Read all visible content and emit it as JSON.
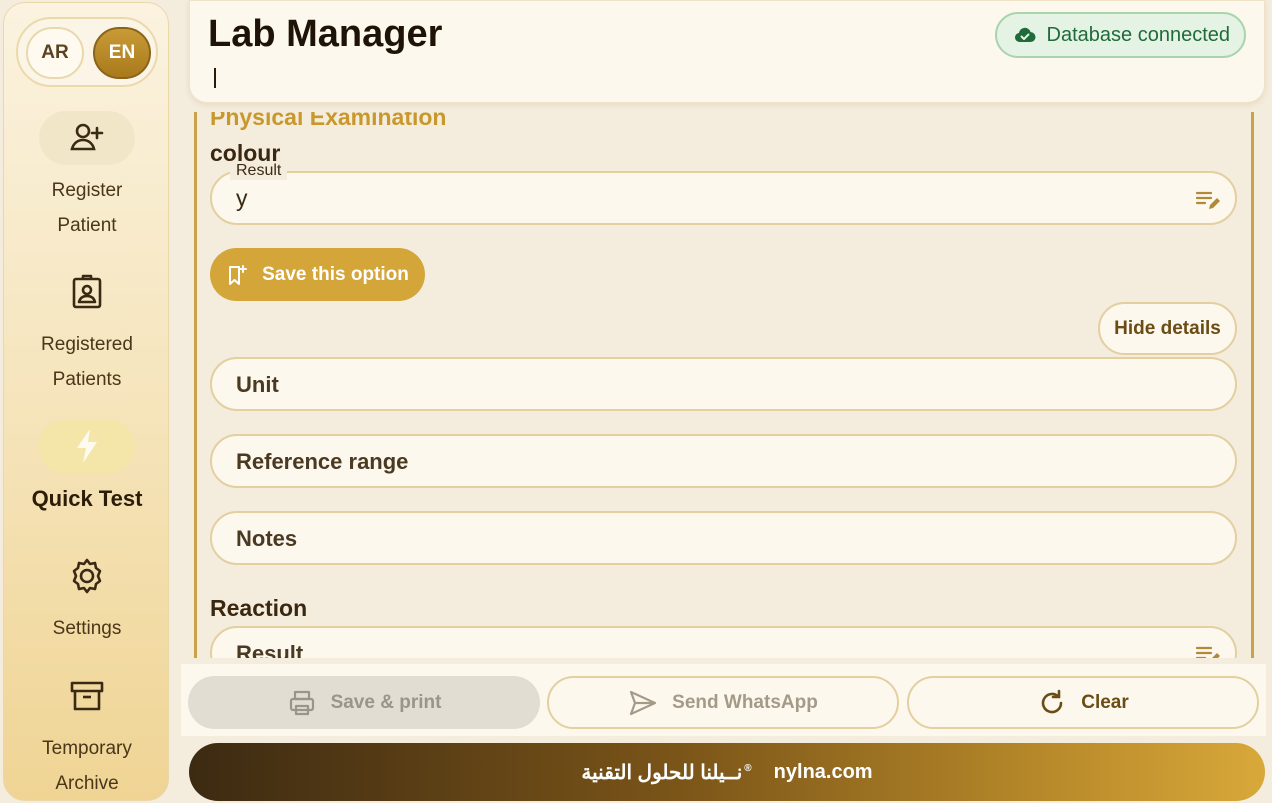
{
  "sidebar": {
    "lang": {
      "ar": "AR",
      "en": "EN",
      "active": "EN"
    },
    "items": [
      {
        "id": "register-patient",
        "line1": "Register",
        "line2": "Patient",
        "icon": "user-plus-icon"
      },
      {
        "id": "registered-patients",
        "line1": "Registered",
        "line2": "Patients",
        "icon": "id-badge-icon"
      },
      {
        "id": "quick-test",
        "line1": "Quick Test",
        "line2": "",
        "icon": "lightning-icon",
        "active": true
      },
      {
        "id": "settings",
        "line1": "Settings",
        "line2": "",
        "icon": "gear-icon"
      },
      {
        "id": "temporary-archive",
        "line1": "Temporary",
        "line2": "Archive",
        "icon": "archive-box-icon"
      }
    ]
  },
  "header": {
    "title": "Lab Manager",
    "db_status": "Database connected",
    "db_status_color": "#1f6b3a"
  },
  "main": {
    "section_title": "Physical Examination",
    "test1": {
      "name": "colour",
      "result_legend": "Result",
      "result_value": "y",
      "save_option_label": "Save this option",
      "hide_details_label": "Hide details",
      "unit_placeholder": "Unit",
      "reference_placeholder": "Reference range",
      "notes_placeholder": "Notes"
    },
    "test2": {
      "name": "Reaction",
      "result_placeholder": "Result"
    }
  },
  "actions": {
    "print_label": "Save & print",
    "whatsapp_label": "Send WhatsApp",
    "clear_label": "Clear"
  },
  "footer": {
    "arabic_brand": "نــيلنا للحلول التقنية",
    "reg_mark": "®",
    "site": "nylna.com"
  },
  "colors": {
    "accent": "#d4a63a",
    "section_title": "#c9982c",
    "border": "#e3cf9f"
  }
}
